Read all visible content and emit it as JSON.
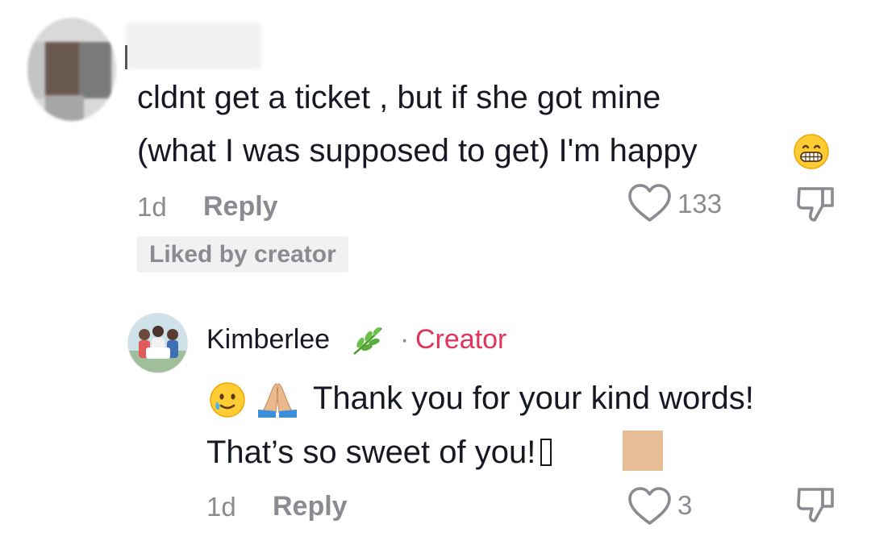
{
  "comment": {
    "line1": "cldnt get a ticket , but if she got mine",
    "line2": "(what I was supposed to get) I'm happy",
    "emoji_icon": "grinning-face-icon",
    "time": "1d",
    "reply_label": "Reply",
    "like_count": "133",
    "liked_badge": "Liked by creator"
  },
  "reply": {
    "author": "Kimberlee",
    "author_emoji_icon": "herb-icon",
    "separator": "·",
    "role": "Creator",
    "emoji_icons": [
      "smiling-face-with-tear-icon",
      "folded-hands-icon"
    ],
    "line1": "Thank you for your kind words!",
    "line2": "That’s so sweet of you!",
    "time": "1d",
    "reply_label": "Reply",
    "like_count": "3"
  },
  "colors": {
    "text": "#161823",
    "muted": "#8a8b91",
    "creator": "#e3335a",
    "badge_bg": "#f1f1f2"
  }
}
